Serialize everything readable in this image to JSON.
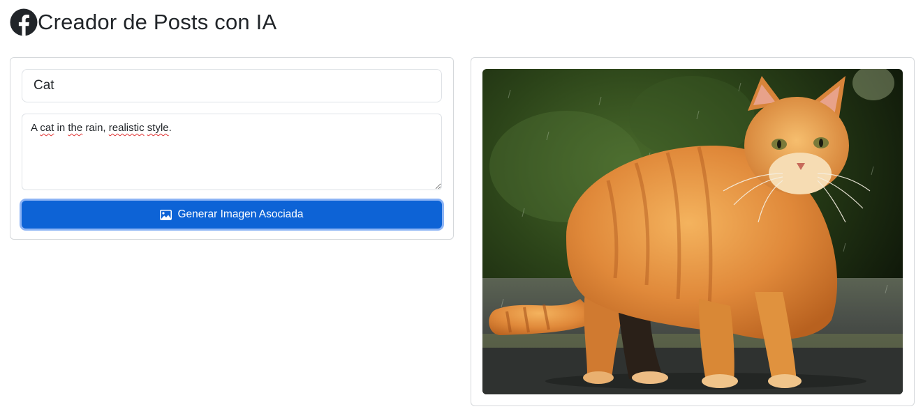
{
  "header": {
    "logo_icon": "facebook-icon",
    "title": "Creador de Posts con IA"
  },
  "form": {
    "title_value": "Cat",
    "prompt_value": "A cat in the rain, realistic style.",
    "generate_button_icon": "image-icon",
    "generate_button_label": "Generar Imagen Asociada"
  },
  "preview": {
    "image_icon": "cat-in-rain-photo"
  },
  "colors": {
    "accent": "#0d63d6",
    "focus_ring": "#8db4f5",
    "border": "#dee2e6",
    "text": "#212529"
  }
}
